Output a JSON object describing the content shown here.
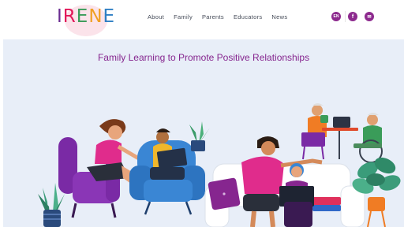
{
  "logo": {
    "letters": [
      "I",
      "R",
      "E",
      "N",
      "E"
    ],
    "colors": [
      "#6a2c91",
      "#e2175a",
      "#3a9c59",
      "#f0a024",
      "#2f7fc4"
    ]
  },
  "nav": {
    "items": [
      "About",
      "Family",
      "Parents",
      "Educators",
      "News"
    ]
  },
  "header_icons": {
    "lang": "EN",
    "facebook": "f",
    "mail": "✉"
  },
  "hero": {
    "title": "Family Learning to Promote Positive Relationships"
  },
  "colors": {
    "brand_purple": "#8d2a8e",
    "hero_bg": "#e8eef8",
    "title_purple": "#86268f"
  }
}
